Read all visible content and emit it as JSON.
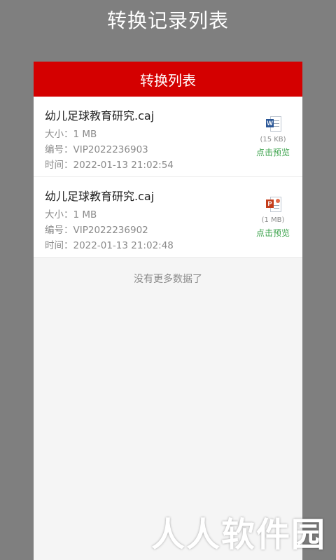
{
  "header": {
    "title": "转换记录列表"
  },
  "panel": {
    "title": "转换列表"
  },
  "records": [
    {
      "file_name": "幼儿足球教育研究.caj",
      "size_label": "大小：",
      "size_value": "1 MB",
      "id_label": "编号：",
      "id_value": "VIP2022236903",
      "time_label": "时间：",
      "time_value": "2022-01-13 21:02:54",
      "icon": "word-doc-icon",
      "file_size_badge": "(15 KB)",
      "preview_label": "点击预览"
    },
    {
      "file_name": "幼儿足球教育研究.caj",
      "size_label": "大小：",
      "size_value": "1 MB",
      "id_label": "编号：",
      "id_value": "VIP2022236902",
      "time_label": "时间：",
      "time_value": "2022-01-13 21:02:48",
      "icon": "powerpoint-doc-icon",
      "file_size_badge": "(1 MB)",
      "preview_label": "点击预览"
    }
  ],
  "footer_note": "没有更多数据了",
  "watermark": "人人软件园",
  "colors": {
    "header_red": "#d40000",
    "preview_green": "#3aa24a",
    "background": "#7f7f7f"
  }
}
